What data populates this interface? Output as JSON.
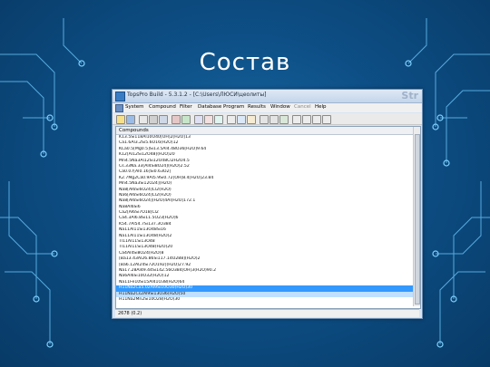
{
  "slide": {
    "title": "Состав"
  },
  "window": {
    "title": "TopsPro Build - 5.3.1.2 - [C:\\Users\\ЛЮСИ\\цеолиты]",
    "brand": "Str"
  },
  "menu": {
    "items": [
      "System",
      "Compound",
      "Filter",
      "Database",
      "Program",
      "Results",
      "Window",
      "Cancel",
      "Help"
    ]
  },
  "list": {
    "header": "Compounds",
    "rows": [
      "K13.5Si118Al10O40[OH]2[H2O]13",
      "Ca1.6Al3.2Si5.6O16(H2O)12",
      "KCa0.5[Mg0.5]Si13.5Al4.48O36[H2O]9.64",
      "K12[Al12Si12O48](H2O)20",
      "Mn4.5Na3Al12Si12O48Cl2H2O4.5",
      "Cs.33Na.33[Al4Si8O24](H2O)2.52",
      "Ca0.07[Al0.16]Si0.63O2]",
      "K2.7Mg2Ca0.9Al5.9Si0.72[OH]8.4[H2O]23.84",
      "Mn4.5Na3Si12O24](H2O)",
      "Na8[Al6Si6O24]Cl2(H2O)",
      "Na6[Al6Si6O24]Cl2(H2O)",
      "Na8[Al6Si6O24](H2O)4Al[H2O]172.1",
      "Na8Al6Si6",
      "Ca2[Al6Si7O18]Cl2",
      "Ca4.3Al6.8Si11.5O23[H2O]6",
      "K54.7Al54.7Si137.3O384",
      "Na11Al11Si13O48Si16",
      "Na11Al11Si13O48(H2O)2",
      "Tl11Al11Si13O48",
      "Tl11Al11Si13O48(H2O)20",
      "Ca4Al4Si8O24(H2O)8",
      "[Ba13.43Al26.86Si117.14O288](H2O)2",
      "[Ba6.12Al24Si72O192](H2O)27.92",
      "Na17.28Al49.44Si142.56O384[OH]3(H2O)90.2",
      "Na6Al6Si10O32(H2O)12",
      "Na11Fe10Si15Al41O38(H2O)64",
      "H11Na2Ca5.02Al9Si10O30(H2O)30",
      "H11Na2Cs2Al9Si13O36(H2O)50",
      "H11Na2Mn2Si10O28(H2O)30"
    ]
  },
  "status": {
    "count": "2678 (0.2)"
  }
}
